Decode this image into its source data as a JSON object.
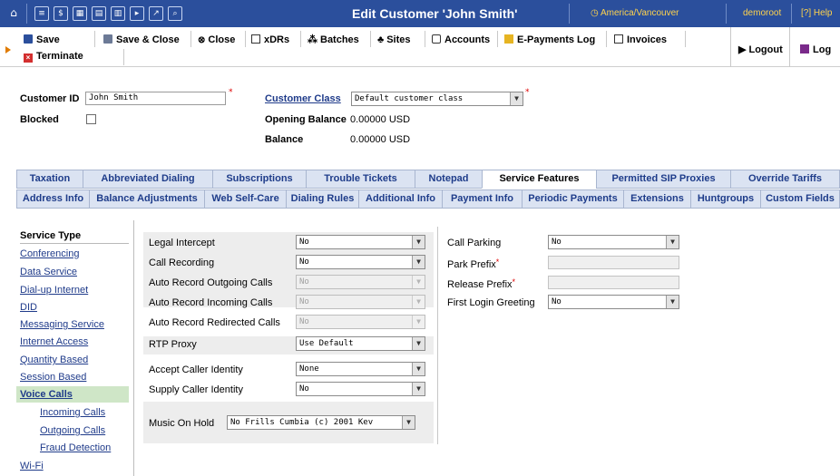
{
  "header": {
    "title": "Edit Customer 'John Smith'",
    "timezone": "America/Vancouver",
    "user": "demoroot",
    "help": "Help"
  },
  "toolbar": {
    "save": "Save",
    "save_close": "Save & Close",
    "close": "Close",
    "xdrs": "xDRs",
    "batches": "Batches",
    "sites": "Sites",
    "accounts": "Accounts",
    "epayments": "E-Payments Log",
    "invoices": "Invoices",
    "terminate": "Terminate",
    "logout": "Logout",
    "log": "Log"
  },
  "customer": {
    "id_label": "Customer ID",
    "id_value": "John Smith",
    "class_label": "Customer Class",
    "class_value": "Default customer class",
    "blocked_label": "Blocked",
    "opening_balance_label": "Opening Balance",
    "opening_balance_value": "0.00000 USD",
    "balance_label": "Balance",
    "balance_value": "0.00000 USD"
  },
  "tabs_row1": [
    "Taxation",
    "Abbreviated Dialing",
    "Subscriptions",
    "Trouble Tickets",
    "Notepad",
    "Service Features",
    "Permitted SIP Proxies",
    "Override Tariffs"
  ],
  "tabs_row2": [
    "Address Info",
    "Balance Adjustments",
    "Web Self-Care",
    "Dialing Rules",
    "Additional Info",
    "Payment Info",
    "Periodic Payments",
    "Extensions",
    "Huntgroups",
    "Custom Fields"
  ],
  "service_types": {
    "title": "Service Type",
    "items": [
      "Conferencing",
      "Data Service",
      "Dial-up Internet",
      "DID",
      "Messaging Service",
      "Internet Access",
      "Quantity Based",
      "Session Based",
      "Voice Calls",
      "Incoming Calls",
      "Outgoing Calls",
      "Fraud Detection",
      "Wi-Fi"
    ]
  },
  "features_left": [
    {
      "label": "Legal Intercept",
      "value": "No"
    },
    {
      "label": "Call Recording",
      "value": "No"
    },
    {
      "label": "Auto Record Outgoing Calls",
      "value": "No"
    },
    {
      "label": "Auto Record Incoming Calls",
      "value": "No"
    },
    {
      "label": "Auto Record Redirected Calls",
      "value": "No"
    },
    {
      "label": "RTP Proxy",
      "value": "Use Default"
    },
    {
      "label": "Accept Caller Identity",
      "value": "None"
    },
    {
      "label": "Supply Caller Identity",
      "value": "No"
    }
  ],
  "music_on_hold": {
    "label": "Music On Hold",
    "value": "No Frills Cumbia (c) 2001 Kev"
  },
  "features_right": [
    {
      "label": "Call Parking",
      "value": "No"
    },
    {
      "label": "Park Prefix",
      "value": ""
    },
    {
      "label": "Release Prefix",
      "value": ""
    },
    {
      "label": "First Login Greeting",
      "value": "No"
    }
  ],
  "colors": {
    "header_bg": "#2b4f9c",
    "accent_yellow": "#ffd34c",
    "link": "#1f3b8a",
    "active_service": "#cfe6c7"
  }
}
